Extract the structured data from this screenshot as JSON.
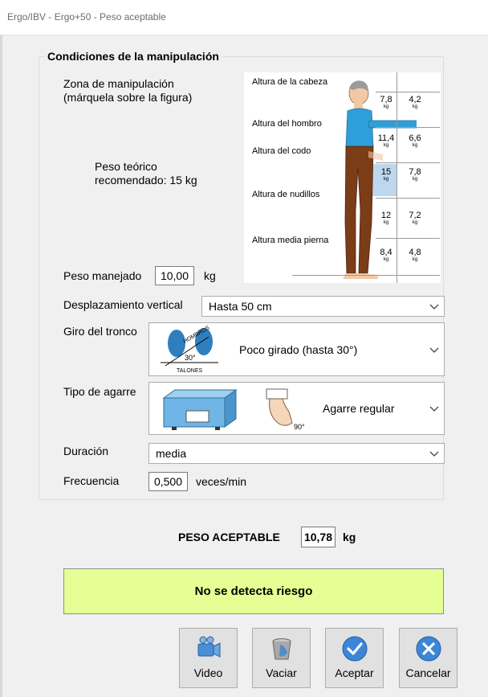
{
  "window": {
    "title": "Ergo/IBV - Ergo+50 - Peso aceptable"
  },
  "group": {
    "title": "Condiciones de la manipulación",
    "zone_label": "Zona de manipulación\n  (márquela sobre la figura)",
    "theoretical_weight": "Peso teórico\nrecomendado: 15 kg"
  },
  "figure": {
    "zones": [
      "Altura de la cabeza",
      "Altura del hombro",
      "Altura del codo",
      "Altura de nudillos",
      "Altura media pierna"
    ],
    "cells": [
      {
        "near": "7,8",
        "far": "4,2"
      },
      {
        "near": "11,4",
        "far": "6,6"
      },
      {
        "near": "15",
        "far": "7,8"
      },
      {
        "near": "12",
        "far": "7,2"
      },
      {
        "near": "8,4",
        "far": "4,8"
      }
    ],
    "unit": "kg",
    "selected_cell": "15",
    "highlight_color": "#bdd7ee"
  },
  "weight": {
    "label": "Peso manejado",
    "value": "10,00",
    "unit": "kg"
  },
  "vertical": {
    "label": "Desplazamiento vertical",
    "selected": "Hasta 50 cm"
  },
  "trunk": {
    "label": "Giro del tronco",
    "selected": "Poco girado (hasta 30°)",
    "img_hombros": "HOMBROS",
    "img_angle": "30°",
    "img_talones": "TALONES"
  },
  "grip": {
    "label": "Tipo de agarre",
    "selected": "Agarre regular",
    "img_angle": "90°"
  },
  "duration": {
    "label": "Duración",
    "selected": "media"
  },
  "frequency": {
    "label": "Frecuencia",
    "value": "0,500",
    "unit": "veces/min"
  },
  "result": {
    "label": "PESO ACEPTABLE",
    "value": "10,78",
    "unit": "kg"
  },
  "risk": {
    "text": "No se detecta riesgo",
    "color": "#e5ff94"
  },
  "buttons": {
    "video": "Video",
    "vaciar": "Vaciar",
    "aceptar": "Aceptar",
    "cancelar": "Cancelar"
  },
  "icons": {
    "video": "video-camera-icon",
    "vaciar": "trash-bin-icon",
    "aceptar": "check-circle-icon",
    "cancelar": "close-circle-icon",
    "dropdown": "chevron-down-icon"
  }
}
